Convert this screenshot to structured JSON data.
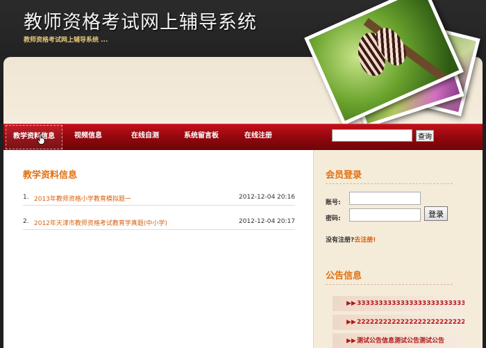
{
  "header": {
    "title": "教师资格考试网上辅导系统",
    "subtitle": "教师资格考试网上辅导系统 ..."
  },
  "nav": {
    "items": [
      "教学资料信息",
      "视频信息",
      "在线自测",
      "系统留言板",
      "在线注册"
    ],
    "active": "教学资料信息",
    "search_value": "",
    "search_button": "查询"
  },
  "main": {
    "section_title": "教学资料信息",
    "articles": [
      {
        "num": "1.",
        "title": "2013年教师资格小学教育模拟题一",
        "date": "2012-12-04 20:16"
      },
      {
        "num": "2.",
        "title": "2012年天津市教师资格考试教育学真题(中小学)",
        "date": "2012-12-04 20:17"
      }
    ]
  },
  "sidebar": {
    "login_title": "会员登录",
    "account_label": "账号:",
    "password_label": "密码:",
    "account_value": "",
    "password_value": "",
    "login_button": "登录",
    "register_prompt": "没有注册?",
    "register_link": "去注册!",
    "notice_title": "公告信息",
    "notices": [
      "333333333333333333333333333",
      "2222222222222222222222222222",
      "测试公告信息测试公告测试公告"
    ]
  },
  "colors": {
    "nav_red": "#a00a12",
    "accent_orange": "#e07010",
    "sidebar_bg": "#f4ebd9",
    "notice_text": "#b01818"
  },
  "icons": {
    "notice_arrow": "double-right-arrow-icon",
    "cursor": "hand-pointer-icon"
  }
}
